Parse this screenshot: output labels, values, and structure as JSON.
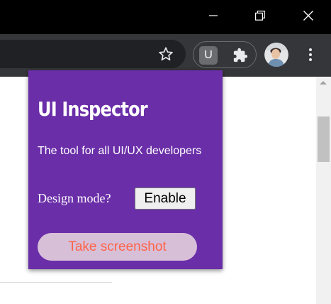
{
  "window": {
    "minimize_icon": "minimize-icon",
    "restore_icon": "restore-icon",
    "close_icon": "close-icon"
  },
  "toolbar": {
    "bookmark_icon": "star-icon",
    "pinned_extension_label": "U",
    "extensions_icon": "puzzle-icon",
    "profile_icon": "avatar",
    "menu_icon": "kebab-menu-icon"
  },
  "popup": {
    "title": "UI Inspector",
    "tagline": "The tool for all UI/UX developers",
    "design_mode_label": "Design mode?",
    "enable_label": "Enable",
    "screenshot_label": "Take screenshot"
  },
  "colors": {
    "titlebar": "#000000",
    "toolbar": "#35363a",
    "omnibox": "#202124",
    "popup_background": "#6a2ea8",
    "screenshot_button_background": "#d8bfd8",
    "screenshot_button_text": "#ff6347",
    "scrollbar_track": "#f1f1f1",
    "scrollbar_thumb": "#c1c1c1"
  }
}
